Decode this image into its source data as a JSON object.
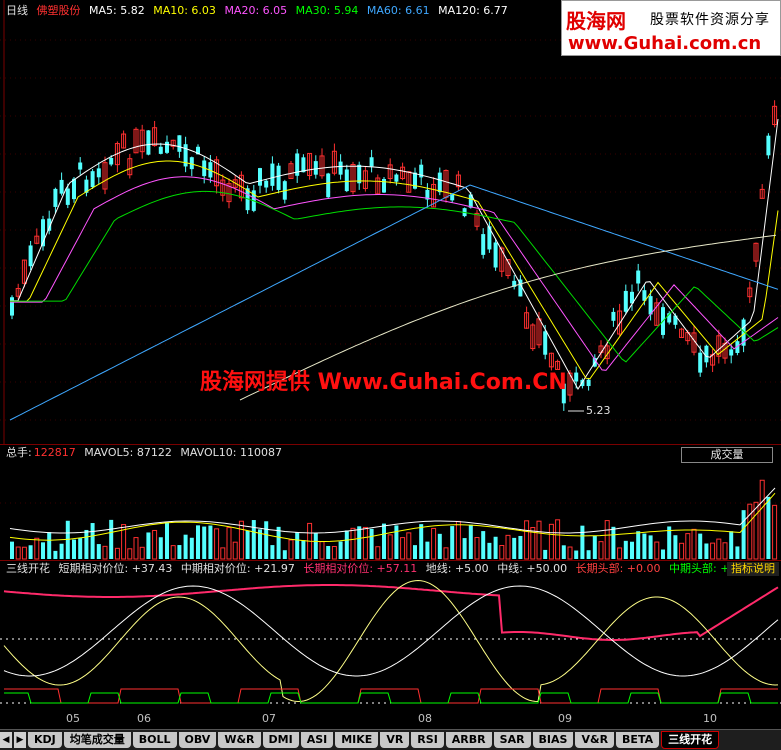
{
  "main_pane": {
    "period": "日线",
    "stock_name": "佛塑股份",
    "ma": [
      {
        "label": "MA5: 5.82",
        "color": "#ffffff"
      },
      {
        "label": "MA10: 6.03",
        "color": "#ffff00"
      },
      {
        "label": "MA20: 6.05",
        "color": "#ff00ff"
      },
      {
        "label": "MA30: 5.94",
        "color": "#00ff00"
      },
      {
        "label": "MA60: 6.61",
        "color": "#3fa8ff"
      },
      {
        "label": "MA120: 6.77",
        "color": "#ffffff"
      }
    ],
    "low_label": "5.23",
    "center_watermark": "股海网提供 Www.Guhai.Com.CN"
  },
  "watermark": {
    "brand": "股海网",
    "slogan": "股票软件资源分享",
    "url": "www.Guhai.com.cn"
  },
  "volume_pane": {
    "total_label": "总手:",
    "total_value": "122817",
    "mavol5": "MAVOL5: 87122",
    "mavol10": "MAVOL10: 110087",
    "indicator_name": "成交量"
  },
  "indicator_pane": {
    "name": "三线开花",
    "items": [
      {
        "label": "短期相对价位: +37.43",
        "color": "#e0e0e0"
      },
      {
        "label": "中期相对价位: +21.97",
        "color": "#e0e0e0"
      },
      {
        "label": "长期相对价位: +57.11",
        "color": "#ff3070"
      },
      {
        "label": "地线: +5.00",
        "color": "#e0e0e0"
      },
      {
        "label": "中线: +50.00",
        "color": "#e0e0e0"
      },
      {
        "label": "长期头部: +0.00",
        "color": "#ff4040"
      },
      {
        "label": "中期头部: +0.0",
        "color": "#00ff00"
      }
    ],
    "help_button": "指标说明"
  },
  "months": [
    "05",
    "06",
    "07",
    "08",
    "09",
    "10"
  ],
  "tabs": [
    "KDJ",
    "均笔成交量",
    "BOLL",
    "OBV",
    "W&R",
    "DMI",
    "ASI",
    "MIKE",
    "VR",
    "RSI",
    "ARBR",
    "SAR",
    "BIAS",
    "V&R",
    "BETA",
    "三线开花"
  ],
  "active_tab": "三线开花",
  "colors": {
    "up": "#ff3030",
    "down": "#54ffff",
    "background": "#000000"
  }
}
